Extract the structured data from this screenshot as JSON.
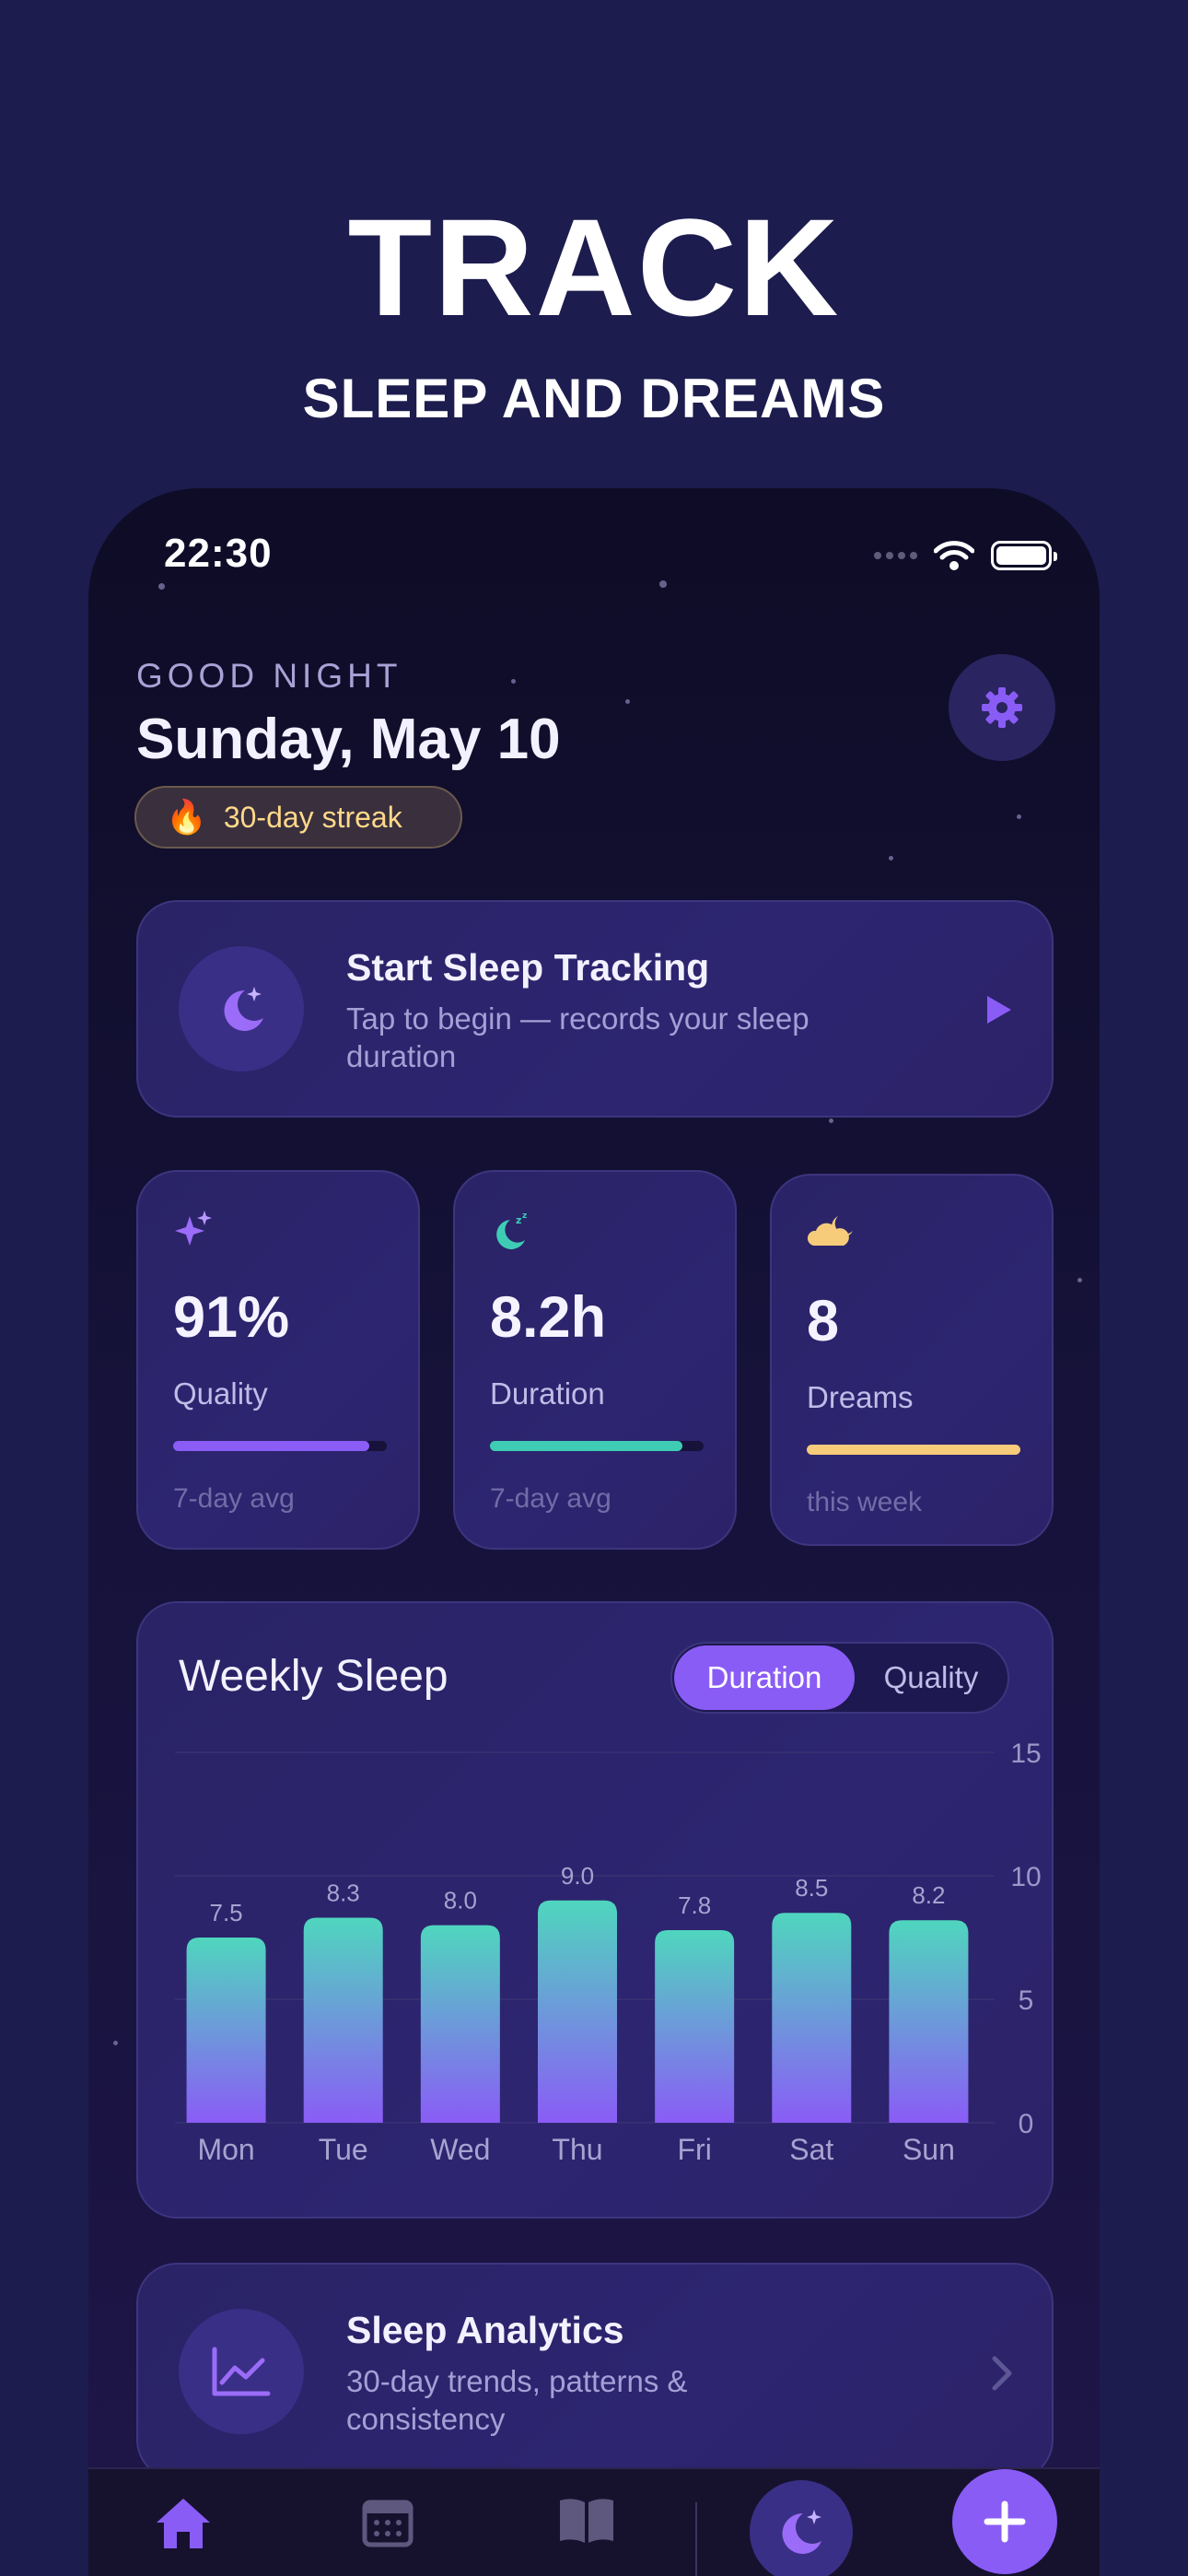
{
  "hero": {
    "title": "TRACK",
    "subtitle": "SLEEP AND DREAMS"
  },
  "status_bar": {
    "time": "22:30"
  },
  "header": {
    "greeting": "GOOD NIGHT",
    "date": "Sunday, May 10",
    "streak": "30-day streak",
    "streak_icon": "🔥"
  },
  "start_tracking": {
    "title": "Start Sleep Tracking",
    "subtitle": "Tap to begin — records your sleep duration"
  },
  "stats": [
    {
      "value": "91%",
      "label": "Quality",
      "footnote": "7-day avg",
      "progress": 0.92,
      "color": "#8b5cf6",
      "icon": "sparkles-icon"
    },
    {
      "value": "8.2h",
      "label": "Duration",
      "footnote": "7-day avg",
      "progress": 0.9,
      "color": "#3ecdb4",
      "icon": "moon-zzz-icon"
    },
    {
      "value": "8",
      "label": "Dreams",
      "footnote": "this week",
      "progress": 1.0,
      "color": "#f6cb7a",
      "icon": "cloud-moon-icon"
    }
  ],
  "weekly": {
    "title": "Weekly Sleep",
    "toggle": {
      "active": "Duration",
      "inactive": "Quality"
    }
  },
  "chart_data": {
    "type": "bar",
    "title": "Weekly Sleep",
    "categories": [
      "Mon",
      "Tue",
      "Wed",
      "Thu",
      "Fri",
      "Sat",
      "Sun"
    ],
    "values": [
      7.5,
      8.3,
      8.0,
      9.0,
      7.8,
      8.5,
      8.2
    ],
    "value_labels": [
      "7.5",
      "8.3",
      "8.0",
      "9.0",
      "7.8",
      "8.5",
      "8.2"
    ],
    "yticks": [
      "0",
      "5",
      "10",
      "15"
    ],
    "ylim": [
      0,
      15
    ],
    "grid": true,
    "bar_gradient": [
      "#4fd6be",
      "#8a5cf6"
    ]
  },
  "analytics": {
    "title": "Sleep Analytics",
    "subtitle": "30-day trends, patterns & consistency"
  },
  "nav": {
    "items": [
      "home-icon",
      "calendar-icon",
      "journal-icon",
      "moon-icon",
      "add-icon"
    ]
  }
}
